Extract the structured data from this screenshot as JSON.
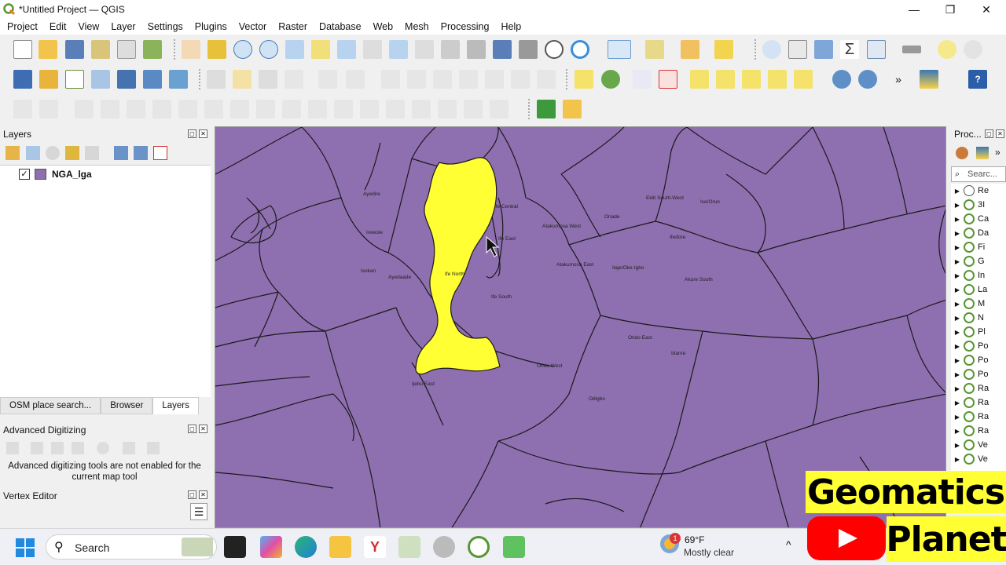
{
  "window": {
    "title": "*Untitled Project — QGIS",
    "minimize": "—",
    "maximize": "❐",
    "close": "✕"
  },
  "menu": [
    "Project",
    "Edit",
    "View",
    "Layer",
    "Settings",
    "Plugins",
    "Vector",
    "Raster",
    "Database",
    "Web",
    "Mesh",
    "Processing",
    "Help"
  ],
  "layers_panel": {
    "title": "Layers",
    "layer": {
      "name": "NGA_lga",
      "checked": true,
      "color": "#8e6fb0"
    }
  },
  "bottom_tabs": [
    "OSM place search...",
    "Browser",
    "Layers"
  ],
  "active_tab": "Layers",
  "advanced_digitizing": {
    "title": "Advanced Digitizing",
    "message": "Advanced digitizing tools are not enabled for the current map tool"
  },
  "vertex_editor": {
    "title": "Vertex Editor"
  },
  "processing": {
    "title": "Proc...",
    "search_placeholder": "Searc...",
    "items": [
      "Re",
      "3I",
      "Ca",
      "Da",
      "Fi",
      "G",
      "In",
      "La",
      "M",
      "N",
      "Pl",
      "Po",
      "Po",
      "Po",
      "Ra",
      "Ra",
      "Ra",
      "Ra",
      "Ve",
      "Ve"
    ]
  },
  "map": {
    "background_color": "#8e6fb0",
    "selected_color": "#ffff33",
    "labels": [
      "Ayedire",
      "Iwo",
      "Irewole",
      "Isokan",
      "Ayedaade",
      "Ife North",
      "Ife Central",
      "Ife East",
      "Ife South",
      "Atakumosa West",
      "Atakumosa East",
      "Oriade",
      "Ekiti South-West",
      "Ise/Orun",
      "Ifedore",
      "Ilesa",
      "Ilaje/Oke-Igbo",
      "Akure South",
      "Ondo East",
      "Idanre",
      "Ondo West",
      "Odigbo",
      "Ijebu East",
      "Ife"
    ]
  },
  "taskbar": {
    "search": "Search",
    "weather_temp": "69°F",
    "weather_desc": "Mostly clear",
    "weather_badge": "1"
  },
  "overlay": {
    "line1": "Geomatics",
    "line2": "Planet"
  }
}
